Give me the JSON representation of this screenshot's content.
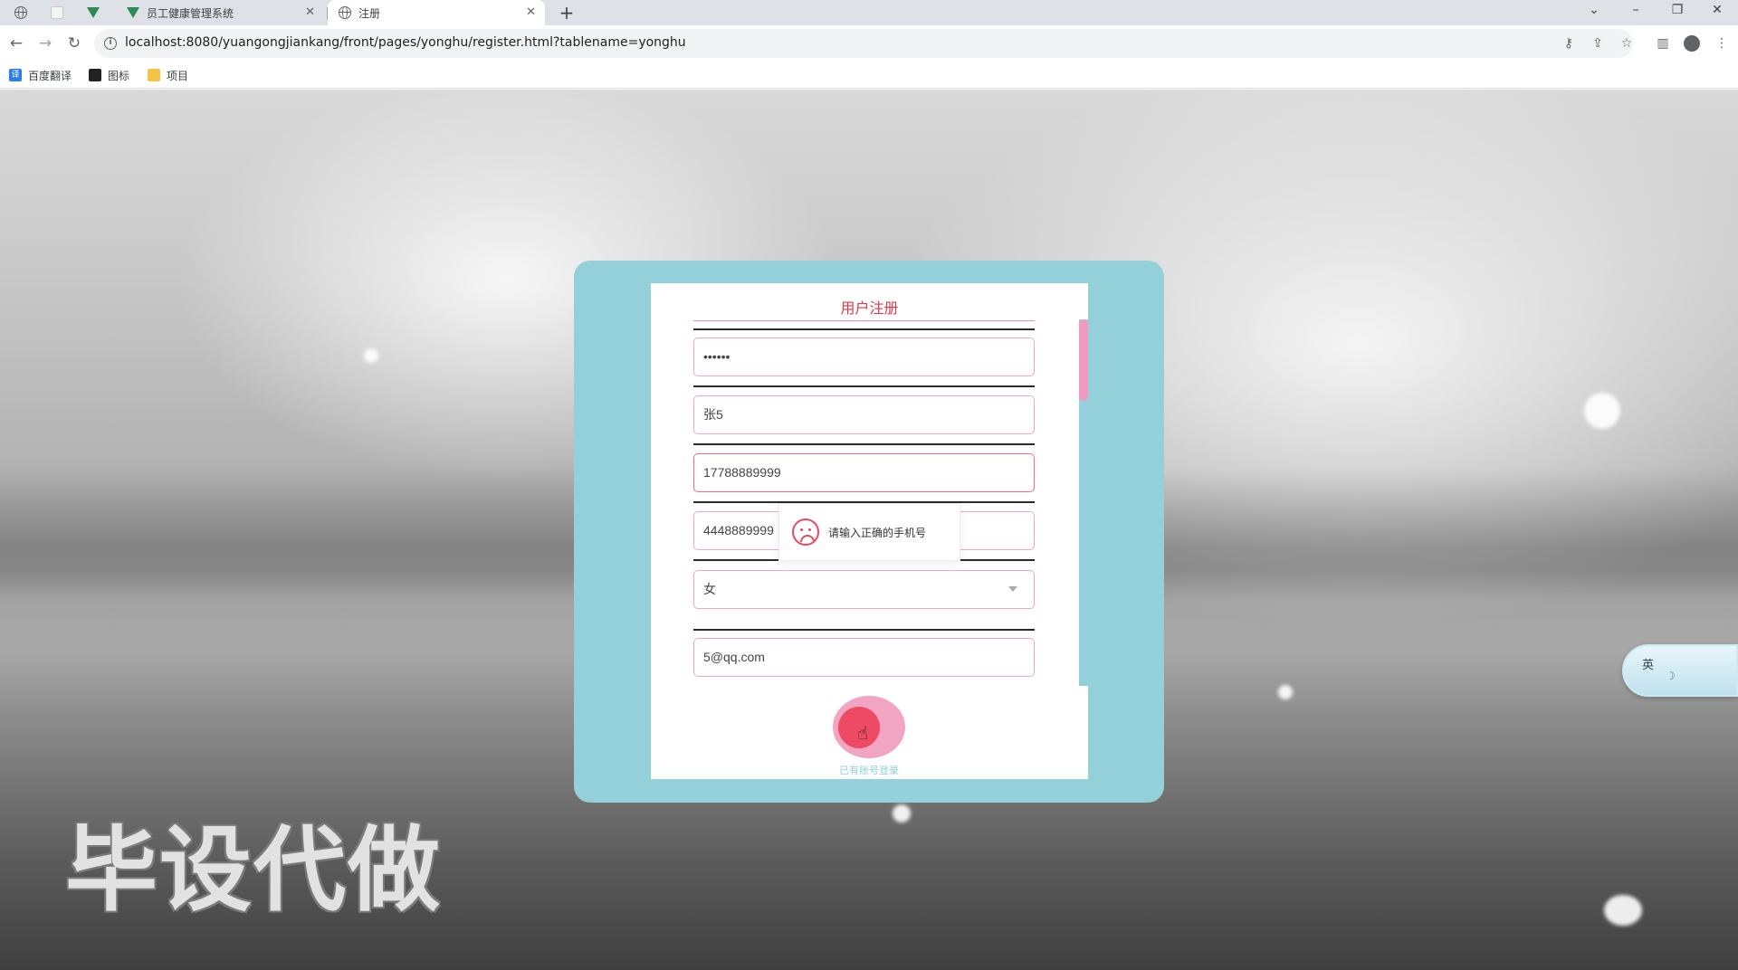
{
  "browser": {
    "tabs": [
      {
        "title": ""
      },
      {
        "title": ""
      },
      {
        "title": ""
      },
      {
        "title": "员工健康管理系统"
      },
      {
        "title": "注册"
      }
    ],
    "new_tab_glyph": "+",
    "close_glyph": "✕",
    "url": "localhost:8080/yuangongjiankang/front/pages/yonghu/register.html?tablename=yonghu",
    "bookmarks": [
      {
        "label": "百度翻译",
        "icon": "baidu-translate-icon"
      },
      {
        "label": "图标",
        "icon": "image-icon"
      },
      {
        "label": "项目",
        "icon": "folder-icon"
      }
    ],
    "bookmark_icon_glyph": "译"
  },
  "form": {
    "title": "用户注册",
    "fields": {
      "password": "••••••",
      "name": "张5",
      "phone": "17788889999",
      "id_number": "4448889999",
      "gender": "女",
      "email": "5@qq.com"
    },
    "login_link": "已有账号登录"
  },
  "toast": {
    "message": "请输入正确的手机号"
  },
  "overlay": {
    "watermark": "毕设代做",
    "ime_label": "英",
    "ime_mode_glyph": "☽"
  },
  "colors": {
    "panel": "#94d0d9",
    "accent": "#e1374a",
    "field_border": "#f2a9bf",
    "button": "#ef4a63"
  }
}
